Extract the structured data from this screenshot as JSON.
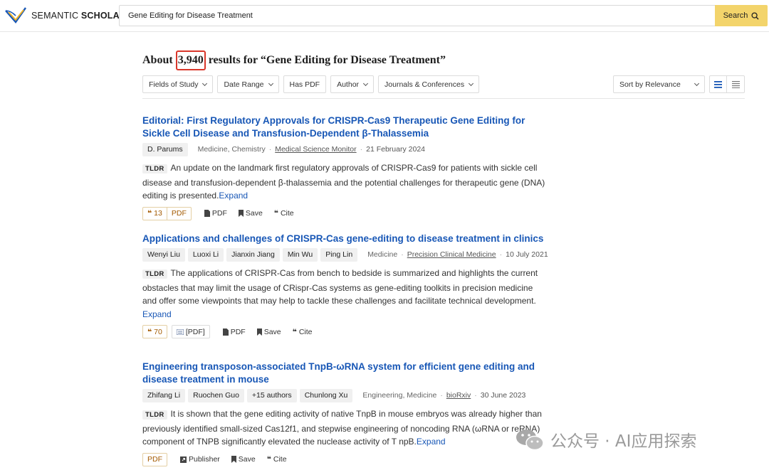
{
  "header": {
    "logo_word1": "SEMANTIC",
    "logo_word2": "SCHOLAR",
    "search_value": "Gene Editing for Disease Treatment",
    "search_button": "Search",
    "search_icon": "search-icon"
  },
  "results": {
    "prefix": "About ",
    "count": "3,940",
    "suffix": " results for “Gene Editing for Disease Treatment”"
  },
  "filters": [
    {
      "label": "Fields of Study"
    },
    {
      "label": "Date Range"
    },
    {
      "label": "Has PDF"
    },
    {
      "label": "Author"
    },
    {
      "label": "Journals & Conferences"
    }
  ],
  "sort": {
    "label": "Sort by Relevance"
  },
  "papers": [
    {
      "title": "Editorial: First Regulatory Approvals for CRISPR-Cas9 Therapeutic Gene Editing for Sickle Cell Disease and Transfusion-Dependent β-Thalassemia",
      "authors": [
        "D. Parums"
      ],
      "fields": "Medicine, Chemistry",
      "venue": "Medical Science Monitor",
      "date": "21 February 2024",
      "tldr_tag": "TLDR",
      "tldr": "An update on the landmark first regulatory approvals of CRISPR-Cas9 for patients with sickle cell disease and transfusion-dependent β-thalassemia and the potential challenges for therapeutic gene (DNA) editing is presented.",
      "expand": "Expand",
      "citations": "13",
      "pdf_badge": "PDF",
      "pdf": "PDF",
      "save": "Save",
      "cite": "Cite"
    },
    {
      "title": "Applications and challenges of CRISPR-Cas gene-editing to disease treatment in clinics",
      "authors": [
        "Wenyi Liu",
        "Luoxi Li",
        "Jianxin Jiang",
        "Min Wu",
        "Ping Lin"
      ],
      "fields": "Medicine",
      "venue": "Precision Clinical Medicine",
      "date": "10 July 2021",
      "tldr_tag": "TLDR",
      "tldr": "The applications of CRISPR-Cas from bench to bedside is summarized and highlights the current obstacles that may limit the usage of CRispr-Cas systems as gene-editing toolkits in precision medicine and offer some viewpoints that may help to tackle these challenges and facilitate technical development.",
      "expand": "Expand",
      "citations": "70",
      "pdf_badge": "[PDF]",
      "pdf": "PDF",
      "save": "Save",
      "cite": "Cite"
    },
    {
      "title": "Engineering transposon-associated TnpB-ωRNA system for efficient gene editing and disease treatment in mouse",
      "authors": [
        "Zhifang Li",
        "Ruochen Guo",
        "+15 authors",
        "Chunlong Xu"
      ],
      "fields": "Engineering, Medicine",
      "venue": "bioRxiv",
      "date": "30 June 2023",
      "tldr_tag": "TLDR",
      "tldr": "It is shown that the gene editing activity of native TnpB in mouse embryos was already higher than previously identified small-sized Cas12f1, and stepwise engineering of noncoding RNA (ωRNA or reRNA) component of TNPB significantly elevated the nuclease activity of T npB.",
      "expand": "Expand",
      "pdf_badge": "PDF",
      "publisher": "Publisher",
      "save": "Save",
      "cite": "Cite"
    }
  ],
  "watermark": {
    "text": "公众号 · AI应用探索"
  },
  "colors": {
    "accent_link": "#1857b6",
    "search_button": "#f3d46b",
    "highlight_box": "#d9372b",
    "citation_badge": "#a35a00"
  }
}
